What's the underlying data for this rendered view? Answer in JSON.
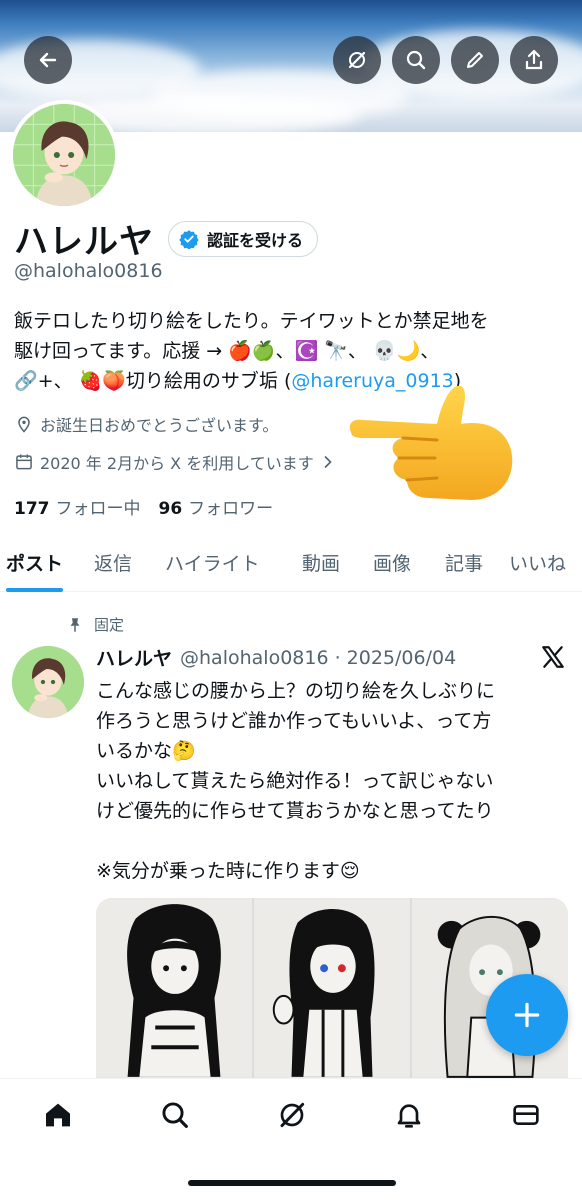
{
  "header": {
    "back_icon": "arrow-left-icon",
    "actions": [
      "grok-icon",
      "search-icon",
      "edit-icon",
      "share-icon"
    ]
  },
  "profile": {
    "name": "ハレルヤ",
    "verify_label": "認証を受ける",
    "handle": "@halohalo0816",
    "bio_line1": "飯テロしたり切り絵をしたり。テイワットとか禁足地を",
    "bio_line2": "駆け回ってます。応援 → 🍎🍏、☪️ 🔭、 💀🌙、",
    "bio_line3_prefix": "🔗+、 🍓🍑切り絵用のサブ垢 (",
    "bio_link": "@hareruya_0913",
    "bio_line3_suffix": ")",
    "location_text": "お誕生日おめでとうございます。",
    "joined_text": "2020 年 2月から X を利用しています",
    "following_count": "177",
    "following_label": "フォロー中",
    "followers_count": "96",
    "followers_label": "フォロワー"
  },
  "tabs": [
    "ポスト",
    "返信",
    "ハイライト",
    "動画",
    "画像",
    "記事",
    "いいね"
  ],
  "post": {
    "pinned_label": "固定",
    "name": "ハレルヤ",
    "handle_date": "@halohalo0816 · 2025/06/04",
    "lines": [
      "こんな感じの腰から上？の切り絵を久しぶりに",
      "作ろうと思うけど誰か作ってもいいよ、って方",
      "いるかな🤔",
      "いいねして貰えたら絶対作る！って訳じゃない",
      "けど優先的に作らせて貰おうかなと思ってたり",
      "",
      "※気分が乗った時に作ります😌"
    ]
  },
  "fab_icon": "plus-icon",
  "bottom_nav": [
    "home-icon",
    "search-icon",
    "grok-icon",
    "bell-icon",
    "mail-icon"
  ],
  "colors": {
    "accent": "#1d9bf0",
    "text": "#0f1419",
    "muted": "#536471"
  }
}
